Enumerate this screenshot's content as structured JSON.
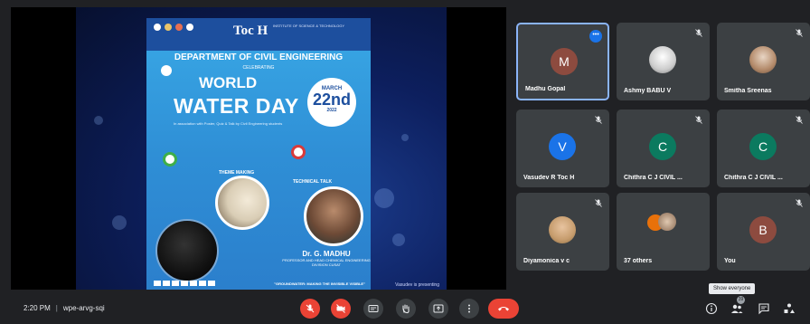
{
  "meeting": {
    "time": "2:20 PM",
    "separator": "|",
    "code": "wpe-arvg-sqi"
  },
  "presentation": {
    "caption": "Vasudev is presenting",
    "poster": {
      "college": "Toc H",
      "college_sub": "INSTITUTE OF SCIENCE & TECHNOLOGY",
      "department": "DEPARTMENT OF CIVIL ENGINEERING",
      "celebrating": "CELEBRATING",
      "title_line1": "WORLD",
      "title_line2": "WATER DAY",
      "date_month": "MARCH",
      "date_day": "22nd",
      "date_year": "2022",
      "small_text": "In association with Poster, Quiz & Talk by Civil Engineering students",
      "theme_label": "THEME MAKING",
      "tech_label": "TECHNICAL TALK",
      "speaker_name": "Dr. G. MADHU",
      "speaker_desc": "PROFESSOR AND HEAD CHEMICAL ENGINEERING DIVISION CUSAT",
      "quote": "\"GROUNDWATER: MAKING THE INVISIBLE VISIBLE\""
    }
  },
  "participants": [
    {
      "name": "Madhu Gopal",
      "initial": "M",
      "color": "#8d4b3f",
      "type": "initial",
      "active": true
    },
    {
      "name": "Ashmy BABU V",
      "initial": "",
      "color": "",
      "type": "photo2",
      "active": false
    },
    {
      "name": "Smitha Sreenas",
      "initial": "",
      "color": "",
      "type": "photo",
      "active": false
    },
    {
      "name": "Vasudev R Toc H",
      "initial": "V",
      "color": "#1a73e8",
      "type": "initial",
      "active": false
    },
    {
      "name": "Chithra C J CIVIL ...",
      "initial": "C",
      "color": "#0b7a5f",
      "type": "initial",
      "active": false
    },
    {
      "name": "Chithra C J CIVIL ...",
      "initial": "C",
      "color": "#0b7a5f",
      "type": "initial",
      "active": false
    },
    {
      "name": "Diyamonica v c",
      "initial": "",
      "color": "",
      "type": "photo3",
      "active": false
    },
    {
      "name": "37 others",
      "initial": "",
      "color": "",
      "type": "cluster",
      "active": false
    },
    {
      "name": "You",
      "initial": "B",
      "color": "#8d4b3f",
      "type": "initial",
      "active": false
    }
  ],
  "tooltip": "Show everyone",
  "people_count": "39",
  "colors": {
    "background": "#202124",
    "tile": "#3c4043",
    "accent": "#8ab4f8",
    "red": "#ea4335"
  },
  "icons": {
    "mic": "mic-off-icon",
    "cam": "camera-off-icon",
    "captions": "captions-icon",
    "hand": "raise-hand-icon",
    "present": "present-icon",
    "more": "more-vert-icon",
    "end": "end-call-icon",
    "info": "info-icon",
    "people": "people-icon",
    "chat": "chat-icon",
    "activities": "activities-icon"
  }
}
